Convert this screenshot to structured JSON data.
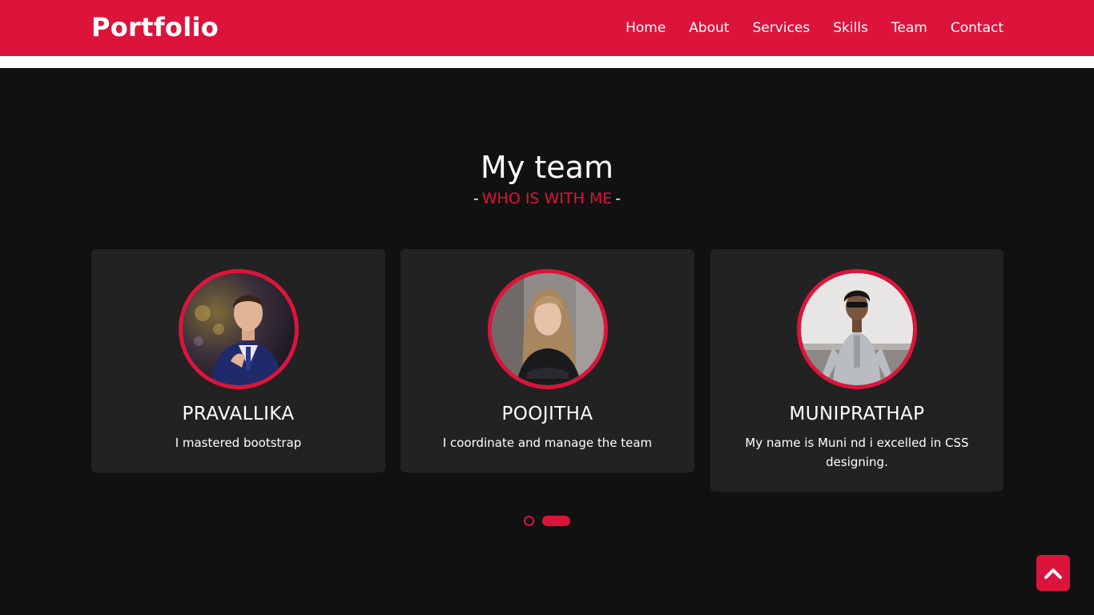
{
  "nav": {
    "logo": "Portfolio",
    "items": [
      "Home",
      "About",
      "Services",
      "Skills",
      "Team",
      "Contact"
    ]
  },
  "team": {
    "title": "My team",
    "subtitle_dash_left": "-",
    "subtitle": "WHO IS WITH ME",
    "subtitle_dash_right": "-",
    "members": [
      {
        "name": "PRAVALLIKA",
        "bio": "I mastered bootstrap"
      },
      {
        "name": "POOJITHA",
        "bio": "I coordinate and manage the team"
      },
      {
        "name": "MUNIPRATHAP",
        "bio": "My name is Muni nd i excelled in CSS designing."
      }
    ]
  },
  "carousel": {
    "pages": 2,
    "active_page": 2
  },
  "colors": {
    "accent": "#dc143c",
    "background": "#111111",
    "card": "#222222"
  },
  "icons": {
    "scroll_top": "chevron-up-icon"
  }
}
